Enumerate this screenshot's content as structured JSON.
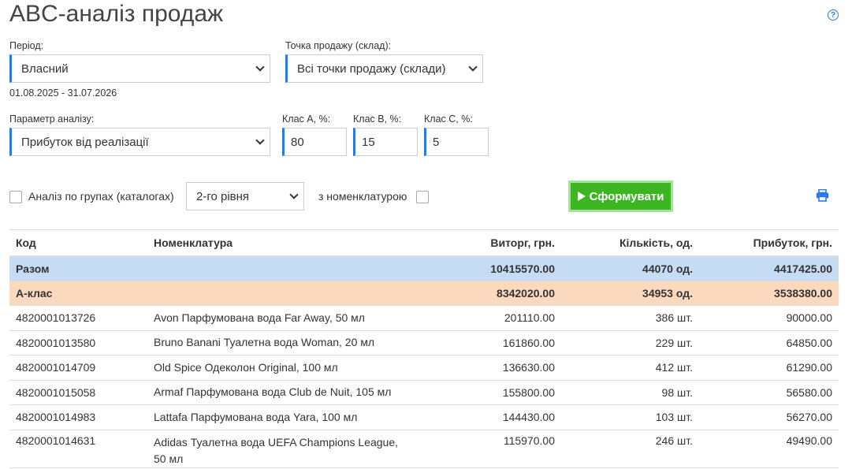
{
  "page": {
    "title": "ABC-аналіз продаж"
  },
  "filters": {
    "period_label": "Період:",
    "period_value": "Власний",
    "date_range": "01.08.2025 - 31.07.2026",
    "point_label": "Точка продажу (склад):",
    "point_value": "Всі точки продажу (склади)",
    "param_label": "Параметр аналізу:",
    "param_value": "Прибуток від реалізації",
    "class_a_label": "Клас А, %:",
    "class_a_value": "80",
    "class_b_label": "Клас В, %:",
    "class_b_value": "15",
    "class_c_label": "Клас С, %:",
    "class_c_value": "5"
  },
  "options": {
    "group_label": "Аналіз по групах (каталогах)",
    "group_checked": false,
    "level_value": "2-го рівня",
    "nomenclature_label": "з номенклатурою",
    "nomenclature_checked": false,
    "run_label": "Сформувати"
  },
  "table": {
    "headers": [
      "Код",
      "Номенклатура",
      "Виторг, грн.",
      "Кількість, од.",
      "Прибуток, грн."
    ],
    "total": {
      "label": "Разом",
      "revenue": "10415570.00",
      "qty": "44070 од.",
      "profit": "4417425.00"
    },
    "class_a": {
      "label": "А-клас",
      "revenue": "8342020.00",
      "qty": "34953 од.",
      "profit": "3538380.00"
    },
    "rows": [
      {
        "code": "4820001013726",
        "name": "Avon Парфумована вода Far Away, 50 мл",
        "revenue": "201110.00",
        "qty": "386 шт.",
        "profit": "90000.00"
      },
      {
        "code": "4820001013580",
        "name": "Bruno Banani Туалетна вода Woman, 20 мл",
        "revenue": "161860.00",
        "qty": "229 шт.",
        "profit": "64850.00"
      },
      {
        "code": "4820001014709",
        "name": "Old Spice Одеколон Original, 100 мл",
        "revenue": "136630.00",
        "qty": "412 шт.",
        "profit": "61290.00"
      },
      {
        "code": "4820001015058",
        "name": "Armaf Парфумована вода Club de Nuit, 105 мл",
        "revenue": "155800.00",
        "qty": "98 шт.",
        "profit": "56580.00"
      },
      {
        "code": "4820001014983",
        "name": "Lattafa Парфумована вода Yara, 100 мл",
        "revenue": "144430.00",
        "qty": "103 шт.",
        "profit": "56270.00"
      },
      {
        "code": "4820001014631",
        "name": "Adidas Туалетна вода UEFA Champions League, 50 мл",
        "revenue": "115970.00",
        "qty": "246 шт.",
        "profit": "49490.00"
      }
    ]
  }
}
